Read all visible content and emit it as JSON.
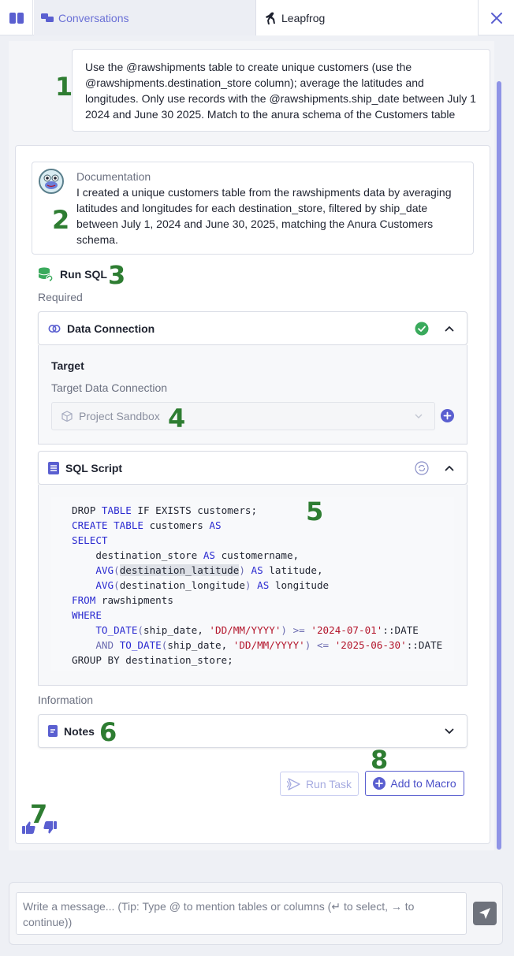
{
  "tabs": {
    "conversations_label": "Conversations",
    "leapfrog_label": "Leapfrog"
  },
  "step_markers": [
    "1",
    "2",
    "3",
    "4",
    "5",
    "6",
    "7",
    "8"
  ],
  "user_message": "Use the @rawshipments table to create unique customers (use the @rawshipments.destination_store column); average the latitudes and longitudes. Only use records with the @rawshipments.ship_date between July 1 2024 and June 30 2025. Match to the anura schema of the Customers table",
  "documentation": {
    "title": "Documentation",
    "text": "I created a unique customers table from the rawshipments data by averaging latitudes and longitudes for each destination_store, filtered by ship_date between July 1, 2024 and June 30, 2025, matching the Anura Customers schema."
  },
  "task": {
    "title": "Run SQL",
    "required_label": "Required",
    "information_label": "Information"
  },
  "data_connection": {
    "title": "Data Connection",
    "target_label": "Target",
    "target_sub_label": "Target Data Connection",
    "selected": "Project Sandbox"
  },
  "sql_script": {
    "title": "SQL Script",
    "lines": [
      [
        {
          "t": "DROP ",
          "c": ""
        },
        {
          "t": "TABLE",
          "c": "kw"
        },
        {
          "t": " IF EXISTS customers;",
          "c": ""
        }
      ],
      [
        {
          "t": "CREATE",
          "c": "kw"
        },
        {
          "t": " ",
          "c": ""
        },
        {
          "t": "TABLE",
          "c": "kw"
        },
        {
          "t": " customers ",
          "c": ""
        },
        {
          "t": "AS",
          "c": "kw"
        }
      ],
      [
        {
          "t": "SELECT",
          "c": "kw"
        }
      ],
      [
        {
          "t": "    destination_store ",
          "c": ""
        },
        {
          "t": "AS",
          "c": "kw"
        },
        {
          "t": " customername,",
          "c": ""
        }
      ],
      [
        {
          "t": "    ",
          "c": ""
        },
        {
          "t": "AVG",
          "c": "fn"
        },
        {
          "t": "(",
          "c": "op"
        },
        {
          "t": "destination_latitude",
          "c": "hl"
        },
        {
          "t": ")",
          "c": "op"
        },
        {
          "t": " ",
          "c": ""
        },
        {
          "t": "AS",
          "c": "kw"
        },
        {
          "t": " latitude,",
          "c": ""
        }
      ],
      [
        {
          "t": "    ",
          "c": ""
        },
        {
          "t": "AVG",
          "c": "fn"
        },
        {
          "t": "(",
          "c": "op"
        },
        {
          "t": "destination_longitude",
          "c": ""
        },
        {
          "t": ")",
          "c": "op"
        },
        {
          "t": " ",
          "c": ""
        },
        {
          "t": "AS",
          "c": "kw"
        },
        {
          "t": " longitude",
          "c": ""
        }
      ],
      [
        {
          "t": "FROM",
          "c": "kw"
        },
        {
          "t": " rawshipments",
          "c": ""
        }
      ],
      [
        {
          "t": "WHERE",
          "c": "kw"
        }
      ],
      [
        {
          "t": "    ",
          "c": ""
        },
        {
          "t": "TO_DATE",
          "c": "fn"
        },
        {
          "t": "(",
          "c": "op"
        },
        {
          "t": "ship_date, ",
          "c": ""
        },
        {
          "t": "'DD/MM/YYYY'",
          "c": "str"
        },
        {
          "t": ")",
          "c": "op"
        },
        {
          "t": " >= ",
          "c": "op"
        },
        {
          "t": "'2024-07-01'",
          "c": "str"
        },
        {
          "t": "::DATE",
          "c": ""
        }
      ],
      [
        {
          "t": "    ",
          "c": ""
        },
        {
          "t": "AND",
          "c": "op"
        },
        {
          "t": " ",
          "c": ""
        },
        {
          "t": "TO_DATE",
          "c": "fn"
        },
        {
          "t": "(",
          "c": "op"
        },
        {
          "t": "ship_date, ",
          "c": ""
        },
        {
          "t": "'DD/MM/YYYY'",
          "c": "str"
        },
        {
          "t": ")",
          "c": "op"
        },
        {
          "t": " <= ",
          "c": "op"
        },
        {
          "t": "'2025-06-30'",
          "c": "str"
        },
        {
          "t": "::DATE",
          "c": ""
        }
      ],
      [
        {
          "t": "GROUP BY destination_store;",
          "c": ""
        }
      ]
    ]
  },
  "notes": {
    "title": "Notes"
  },
  "buttons": {
    "run_task": "Run Task",
    "add_to_macro": "Add to Macro"
  },
  "composer": {
    "placeholder": "Write a message... (Tip: Type @ to mention tables or columns (↵ to select, → to continue))",
    "value": ""
  },
  "colors": {
    "accent": "#5a5fd0",
    "step_marker": "#2e7d32",
    "success": "#3aaa5c"
  }
}
